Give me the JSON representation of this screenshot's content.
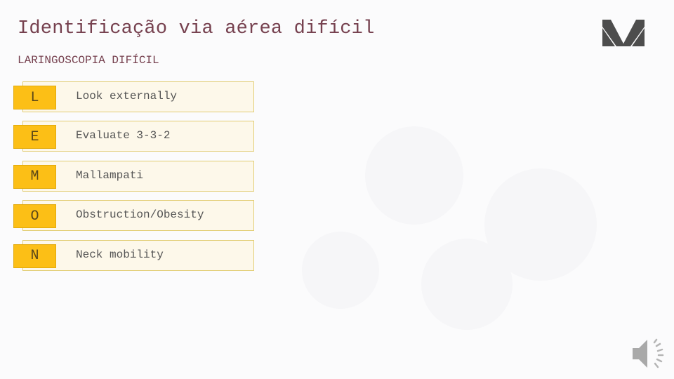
{
  "slide": {
    "title": "Identificação via aérea difícil",
    "subtitle": "LARINGOSCOPIA DIFÍCIL"
  },
  "mnemonic": {
    "items": [
      {
        "letter": "L",
        "text": "Look externally"
      },
      {
        "letter": "E",
        "text": "Evaluate 3-3-2"
      },
      {
        "letter": "M",
        "text": "Mallampati"
      },
      {
        "letter": "O",
        "text": "Obstruction/Obesity"
      },
      {
        "letter": "N",
        "text": "Neck mobility"
      }
    ]
  },
  "icons": {
    "logo": "m-logo-icon",
    "audio": "speaker-icon"
  },
  "colors": {
    "title": "#76414f",
    "letter_box": "#fcbf16",
    "bar_fill": "#fdf8ea",
    "bar_border": "#e2cd74",
    "logo": "#4d4d4d",
    "text": "#545454"
  }
}
